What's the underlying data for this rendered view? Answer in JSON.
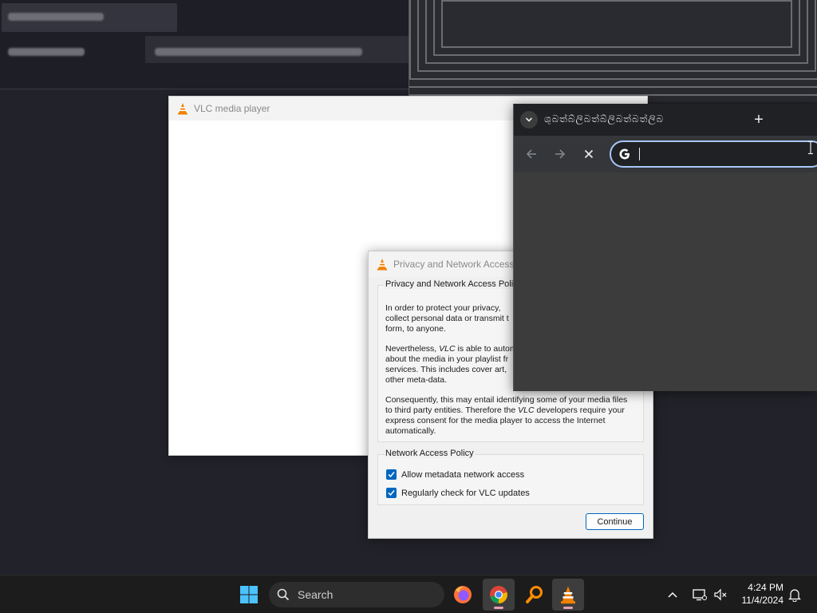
{
  "vlc_main": {
    "title": "VLC media player"
  },
  "dialog": {
    "title": "Privacy and Network Access",
    "policy_group": {
      "legend": "Privacy and Network Access Policy",
      "para1": "In order to protect your privacy, collect personal data or transmit form, to anyone.",
      "para1_line1": "In order to protect your privacy,",
      "para1_line2": "collect personal data or transmit t",
      "para1_line3": "form, to anyone.",
      "para2_line1_a": "Nevertheless, ",
      "para2_line1_vlc": "VLC",
      "para2_line1_b": " is able to autom",
      "para2_line2": "about the media in your playlist fr",
      "para2_line3": "services. This includes cover art,",
      "para2_line4": "other meta-data.",
      "para3_line1": "Consequently, this may entail identifying some of your media files",
      "para3_line2_a": "to third party entities. Therefore the ",
      "para3_line2_vlc": "VLC",
      "para3_line2_b": " developers require your",
      "para3_line3": "express consent for the media player to access the Internet",
      "para3_line4": "automatically."
    },
    "network_group": {
      "legend": "Network Access Policy",
      "options": [
        {
          "label": "Allow metadata network access",
          "checked": true
        },
        {
          "label": "Regularly check for VLC updates",
          "checked": true
        }
      ]
    },
    "continue_label": "Continue"
  },
  "chrome": {
    "tab_title": "ශුබත්බ්ලිබත්බ්ලිබත්බත්ලිබ",
    "new_tab_symbol": "+",
    "omnibox_value": ""
  },
  "taskbar": {
    "search_label": "Search",
    "time": "4:24 PM",
    "date": "11/4/2024",
    "pinned": [
      "start-button",
      "search",
      "firefox",
      "chrome",
      "search-everything",
      "vlc"
    ]
  },
  "colors": {
    "accent": "#0067c0",
    "vlc_orange": "#f08000",
    "taskbar_bg": "#1c1c1c"
  }
}
